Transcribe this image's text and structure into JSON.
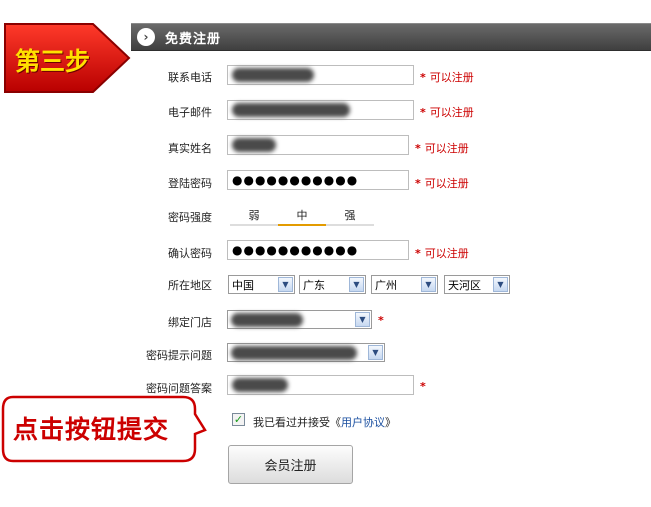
{
  "header": {
    "title": "免费注册"
  },
  "step_tag": {
    "text": "第三步"
  },
  "fields": {
    "phone": {
      "label": "联系电话",
      "hint": "可以注册"
    },
    "email": {
      "label": "电子邮件",
      "hint": "可以注册"
    },
    "name": {
      "label": "真实姓名",
      "hint": "可以注册"
    },
    "password": {
      "label": "登陆密码",
      "value": "●●●●●●●●●●●",
      "hint": "可以注册"
    },
    "strength": {
      "label": "密码强度",
      "levels": [
        "弱",
        "中",
        "强"
      ]
    },
    "confirm": {
      "label": "确认密码",
      "value": "●●●●●●●●●●●",
      "hint": "可以注册"
    },
    "region": {
      "label": "所在地区",
      "country": "中国",
      "province": "广东",
      "city": "广州",
      "district": "天河区"
    },
    "store": {
      "label": "绑定门店"
    },
    "question": {
      "label": "密码提示问题"
    },
    "answer": {
      "label": "密码问题答案"
    }
  },
  "required_mark": "*",
  "callout": {
    "text": "点击按钮提交"
  },
  "agreement": {
    "prefix": "我已看过并接受《",
    "link": "用户协议",
    "suffix": "》",
    "checked": true
  },
  "submit": {
    "label": "会员注册"
  },
  "colors": {
    "accent_red": "#cc0000",
    "step_yellow": "#ffe100",
    "header_gray": "#4a4a4a",
    "strength_active": "#e39b00"
  }
}
